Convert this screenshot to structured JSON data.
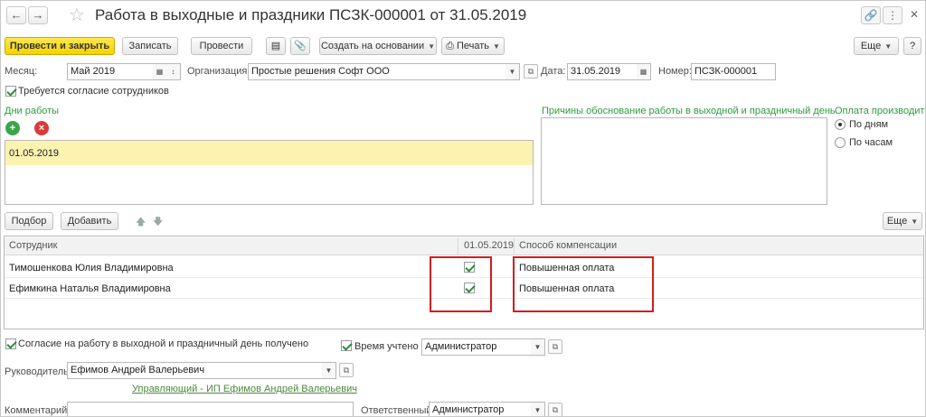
{
  "window": {
    "title": "Работа в выходные и праздники ПСЗК-000001 от 31.05.2019"
  },
  "toolbar": {
    "post_close": "Провести и закрыть",
    "save": "Записать",
    "post": "Провести",
    "create_based": "Создать на основании",
    "print": "Печать",
    "more": "Еще",
    "help": "?"
  },
  "header": {
    "month_label": "Месяц:",
    "month_value": "Май 2019",
    "org_label": "Организация:",
    "org_value": "Простые решения Софт ООО",
    "date_label": "Дата:",
    "date_value": "31.05.2019",
    "number_label": "Номер:",
    "number_value": "ПСЗК-000001",
    "consent_required": "Требуется согласие сотрудников"
  },
  "work_days": {
    "title": "Дни работы",
    "items": [
      "01.05.2019"
    ]
  },
  "reasons": {
    "title": "Причины обоснование работы в выходной и праздничный день",
    "value": ""
  },
  "payment": {
    "title": "Оплата производится",
    "options": [
      "По дням",
      "По часам"
    ],
    "selected": "По дням"
  },
  "table_toolbar": {
    "pick": "Подбор",
    "add": "Добавить",
    "more": "Еще"
  },
  "table": {
    "columns": [
      "Сотрудник",
      "01.05.2019",
      "Способ компенсации"
    ],
    "rows": [
      {
        "employee": "Тимошенкова Юлия Владимировна",
        "checked": true,
        "compensation": "Повышенная оплата"
      },
      {
        "employee": "Ефимкина Наталья Владимировна",
        "checked": true,
        "compensation": "Повышенная оплата"
      }
    ]
  },
  "footer": {
    "consent_received": "Согласие на работу в выходной и праздничный день получено",
    "time_recorded": "Время учтено",
    "time_recorded_value": "Администратор",
    "manager_label": "Руководитель:",
    "manager_value": "Ефимов Андрей Валерьевич",
    "manager_link": "Управляющий - ИП Ефимов Андрей Валерьевич",
    "comment_label": "Комментарий:",
    "comment_value": "",
    "responsible_label": "Ответственный:",
    "responsible_value": "Администратор"
  },
  "colors": {
    "primary_button": "#f5d200",
    "section_title": "#2e9b3f",
    "selection_yellow": "#fdf3b0",
    "highlight_red": "#d21e1e"
  }
}
